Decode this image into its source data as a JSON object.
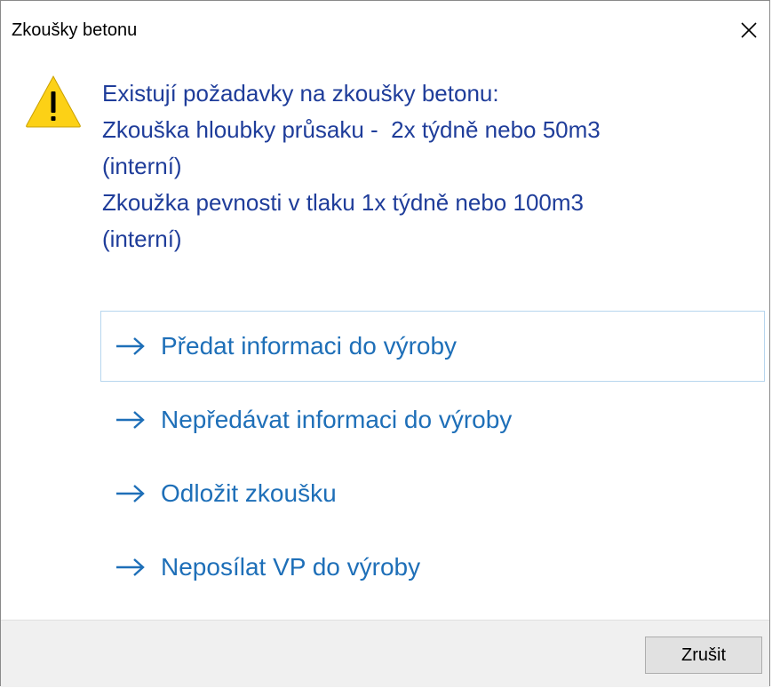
{
  "window": {
    "title": "Zkoušky betonu",
    "close_icon": "close-icon"
  },
  "message": {
    "icon": "warning-icon",
    "lines": [
      "Existují požadavky na zkoušky betonu:",
      "Zkouška hloubky průsaku -  2x týdně nebo 50m3",
      "(interní)",
      "Zkoužka pevnosti v tlaku 1x týdně nebo 100m3",
      "(interní)"
    ]
  },
  "commands": [
    {
      "label": "Předat informaci do výroby",
      "icon": "arrow-right-icon"
    },
    {
      "label": "Nepředávat informaci do výroby",
      "icon": "arrow-right-icon"
    },
    {
      "label": "Odložit zkoušku",
      "icon": "arrow-right-icon"
    },
    {
      "label": "Neposílat VP do výroby",
      "icon": "arrow-right-icon"
    }
  ],
  "footer": {
    "cancel_label": "Zrušit"
  },
  "colors": {
    "message_text": "#1f3d9a",
    "command_link": "#1e6fb8",
    "warning_fill": "#fcd116",
    "footer_bg": "#f0f0f0"
  }
}
